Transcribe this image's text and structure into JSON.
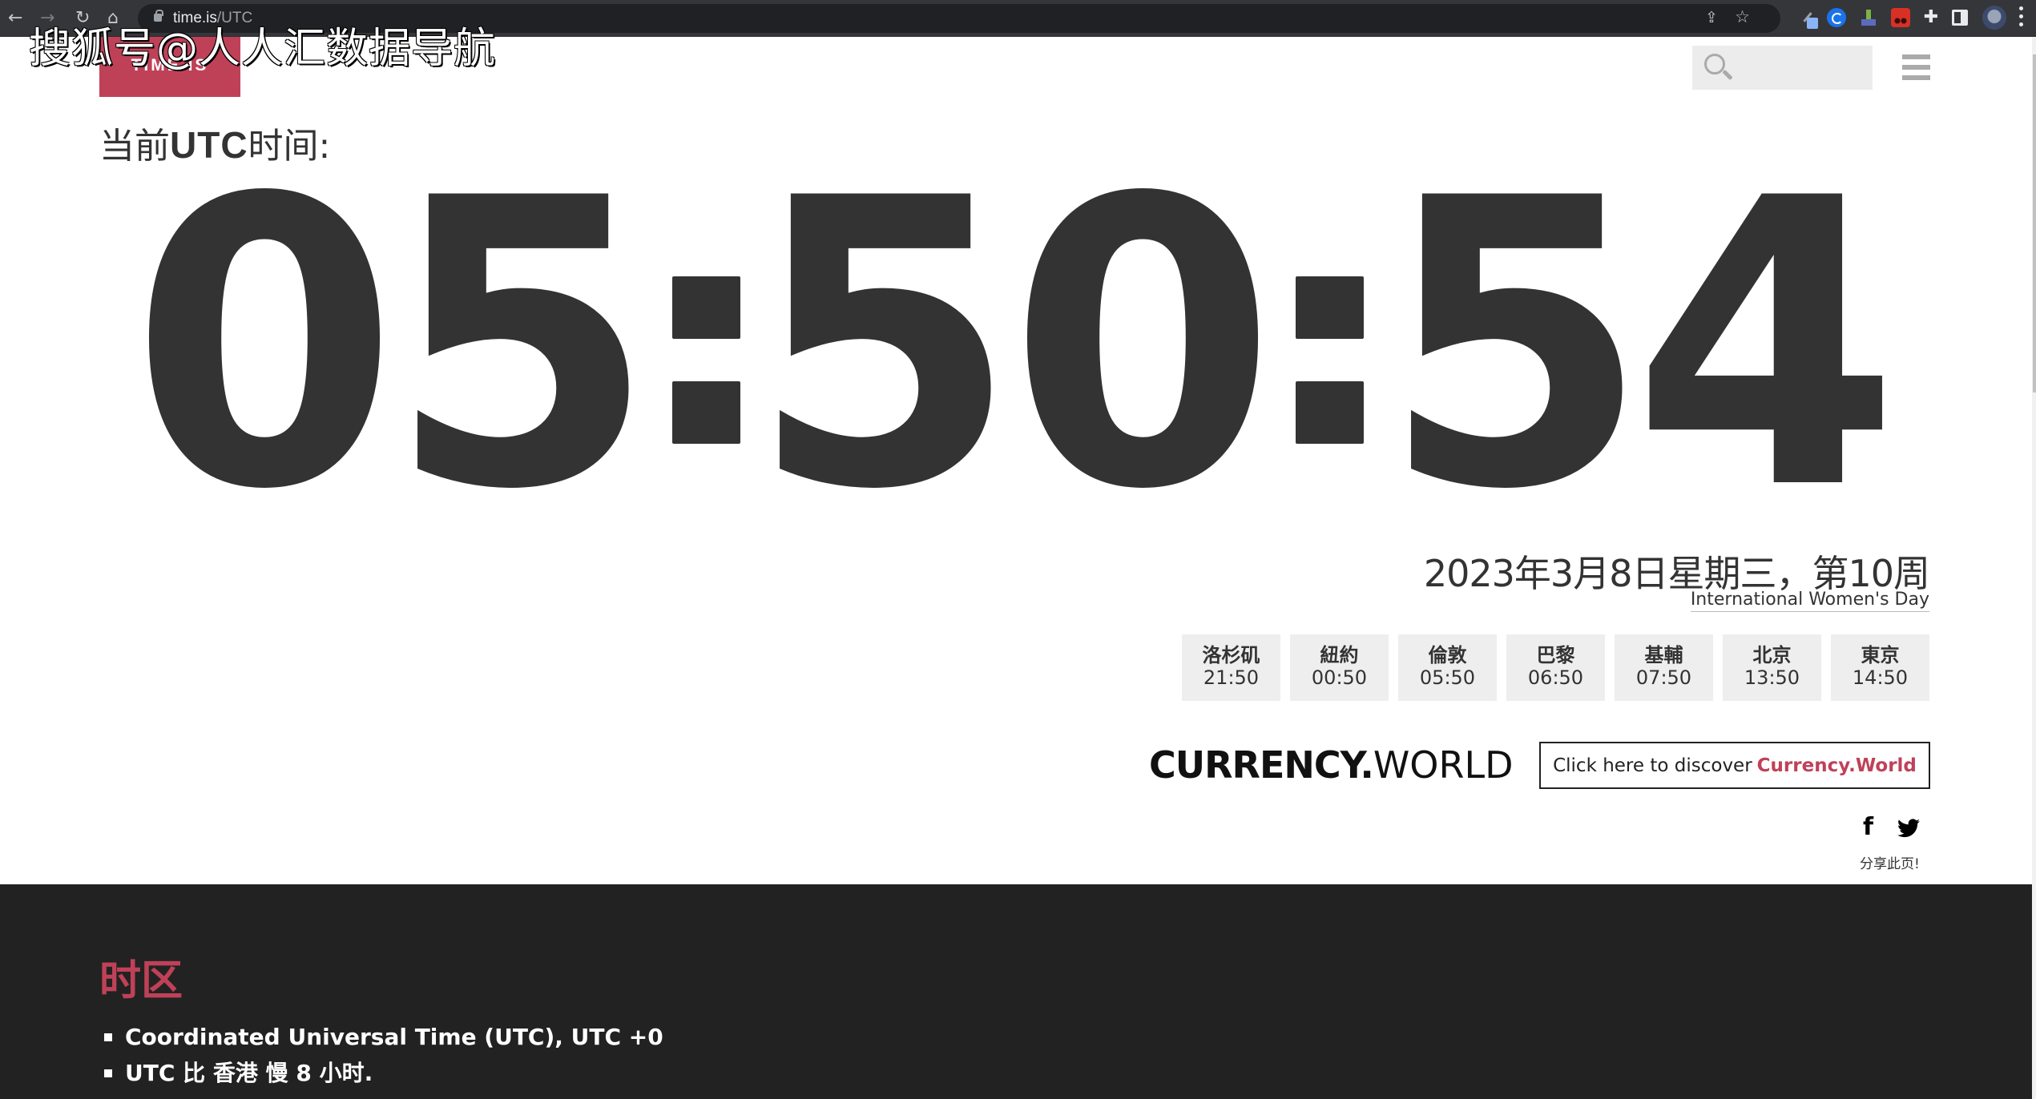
{
  "browser": {
    "url_host": "time.is",
    "url_path": "/UTC",
    "back_icon": "←",
    "forward_icon": "→",
    "reload_icon": "↻",
    "home_icon": "⌂",
    "share_icon": "⇪",
    "star_icon": "☆",
    "puzzle_icon": "✚"
  },
  "watermark": "搜狐号@人人汇数据导航",
  "header": {
    "logo_text": "TIME.IS",
    "search_placeholder": ""
  },
  "title": {
    "prefix": "当前",
    "bold": "UTC",
    "suffix": "时间:"
  },
  "clock": {
    "time": "05:50:54",
    "hours": "05",
    "minutes": "50",
    "seconds": "54",
    "digits": [
      "0",
      "5",
      "5",
      "0",
      "5",
      "4"
    ]
  },
  "date": {
    "full": "2023年3月8日星期三，第10周",
    "holiday": "International Women's Day"
  },
  "cities": [
    {
      "name": "洛杉矶",
      "time": "21:50"
    },
    {
      "name": "紐約",
      "time": "00:50"
    },
    {
      "name": "倫敦",
      "time": "05:50"
    },
    {
      "name": "巴黎",
      "time": "06:50"
    },
    {
      "name": "基輔",
      "time": "07:50"
    },
    {
      "name": "北京",
      "time": "13:50"
    },
    {
      "name": "東京",
      "time": "14:50"
    }
  ],
  "currency": {
    "brand_bold": "CURRENCY.",
    "brand_light": "WORLD",
    "button_prefix": "Click here to discover",
    "button_link": "Currency.World"
  },
  "share": {
    "facebook_icon": "f",
    "label": "分享此页!"
  },
  "footer": {
    "heading": "时区",
    "items": [
      "Coordinated Universal Time (UTC), UTC +0",
      "UTC 比 香港 慢 8 小时."
    ]
  },
  "colors": {
    "accent": "#bf4158",
    "text": "#333333",
    "footer_bg": "#222222",
    "city_bg": "#eeeeee"
  }
}
